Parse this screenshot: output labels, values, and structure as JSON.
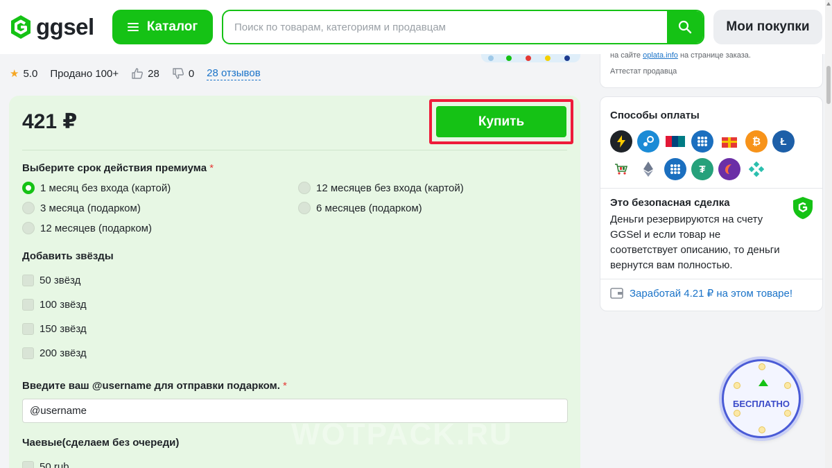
{
  "header": {
    "logo_text": "ggsel",
    "catalog_label": "Каталог",
    "search_placeholder": "Поиск по товарам, категориям и продавцам",
    "purchases_label": "Мои покупки"
  },
  "stats": {
    "rating": "5.0",
    "sold": "Продано 100+",
    "likes": "28",
    "dislikes": "0",
    "reviews": "28 отзывов"
  },
  "product": {
    "price": "421 ₽",
    "buy_label": "Купить",
    "premium": {
      "title": "Выберите срок действия премиума",
      "required_mark": "*",
      "options": [
        "1 месяц без входа (картой)",
        "12 месяцев без входа (картой)",
        "3 месяца (подарком)",
        "6 месяцев (подарком)",
        "12 месяцев (подарком)"
      ],
      "selected": "1 месяц без входа (картой)"
    },
    "stars": {
      "title": "Добавить звёзды",
      "options": [
        "50 звёзд",
        "100 звёзд",
        "150 звёзд",
        "200 звёзд"
      ]
    },
    "username": {
      "title": "Введите ваш @username для отправки подарком.",
      "required_mark": "*",
      "value": "@username"
    },
    "tips": {
      "title": "Чаевые(сделаем без очереди)",
      "first_option": "50 rub"
    }
  },
  "sidebar": {
    "top_line_prefix": "на сайте",
    "top_line_link": "oplata.info",
    "top_line_suffix": "на странице заказа.",
    "seller_attest": "Аттестат продавца",
    "payment_title": "Способы оплаты",
    "payment_icons": [
      "lightning-icon",
      "steam-icon",
      "unionpay-icon",
      "webmoney-icon",
      "gift-icon",
      "bitcoin-icon",
      "litecoin-icon",
      "cart-icon",
      "ethereum-icon",
      "webmoney-icon",
      "tether-icon",
      "phone-icon",
      "diamond-icon"
    ],
    "safe_title": "Это безопасная сделка",
    "safe_text": "Деньги резервируются на счету GGSel и если товар не соответствует описанию, то деньги вернутся вам полностью.",
    "earn_text": "Заработай 4.21 ₽ на этом товаре!"
  },
  "badge": {
    "label": "БЕСПЛАТНО"
  },
  "colors": {
    "brand_green": "#15c215",
    "highlight_red": "#ee1c3a",
    "link_blue": "#1a73c8",
    "card_green": "#e7f7e4"
  }
}
